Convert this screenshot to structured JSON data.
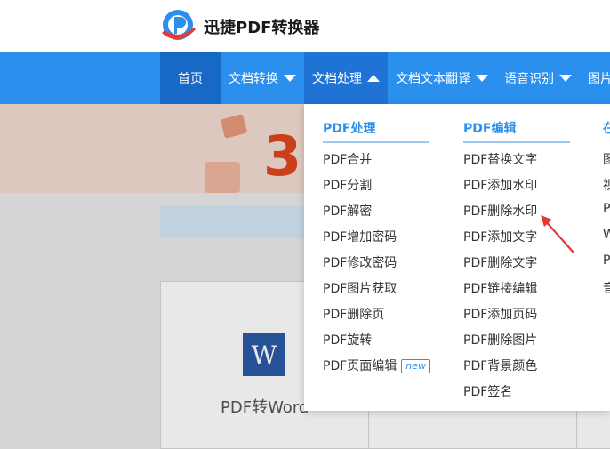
{
  "header": {
    "brand": "迅捷PDF转换器"
  },
  "nav": {
    "items": [
      {
        "label": "首页"
      },
      {
        "label": "文档转换"
      },
      {
        "label": "文档处理"
      },
      {
        "label": "文档文本翻译"
      },
      {
        "label": "语音识别"
      },
      {
        "label": "图片"
      }
    ]
  },
  "banner": {
    "number": "3"
  },
  "card": {
    "icon_letter": "W",
    "label": "PDF转Word"
  },
  "dropdown": {
    "columns": [
      {
        "title": "PDF处理",
        "items": [
          "PDF合并",
          "PDF分割",
          "PDF解密",
          "PDF增加密码",
          "PDF修改密码",
          "PDF图片获取",
          "PDF删除页",
          "PDF旋转",
          "PDF页面编辑"
        ],
        "badge": "new"
      },
      {
        "title": "PDF编辑",
        "items": [
          "PDF替换文字",
          "PDF添加水印",
          "PDF删除水印",
          "PDF添加文字",
          "PDF删除文字",
          "PDF链接编辑",
          "PDF添加页码",
          "PDF删除图片",
          "PDF背景颜色",
          "PDF签名"
        ]
      },
      {
        "title": "在",
        "items": [
          "图",
          "视",
          "P",
          "W",
          "P",
          "音"
        ]
      }
    ]
  },
  "colors": {
    "nav": "#2b8fed",
    "nav_active": "#1769c6",
    "accent": "#2b8fed",
    "arrow": "#e53935"
  }
}
